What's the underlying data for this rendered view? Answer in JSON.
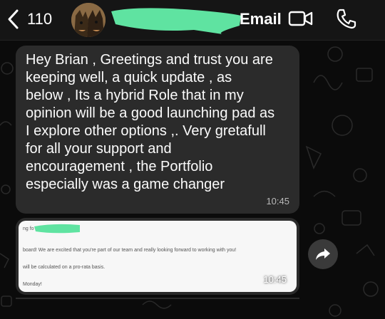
{
  "header": {
    "back_count": "110",
    "contact_name": "Email",
    "icons": {
      "back": "chevron-left-icon",
      "video": "video-camera-icon",
      "call": "phone-icon"
    },
    "redaction_color": "#5fe3a1"
  },
  "messages": [
    {
      "text": "Hey Brian , Greetings and trust you are\nkeeping well,  a quick update ,  as\nbelow , Its a hybrid Role that in my\nopinion will be a good launching pad as\nI explore other options ,. Very gretafull\nfor all your support and\nencouragement ,  the Portfolio\nespecially   was a game changer",
      "time": "10:45"
    },
    {
      "image_lines": [
        "ng fo",
        "board!  We are excited that you're part of our team and really looking forward to working with you!",
        "will be calculated on a pro-rata basis.",
        "Monday!"
      ],
      "time": "10:45"
    }
  ],
  "forward_icon": "forward-arrow-icon",
  "colors": {
    "bubble": "#2b2b2b",
    "header": "#151515",
    "background": "#0b0b0b"
  }
}
